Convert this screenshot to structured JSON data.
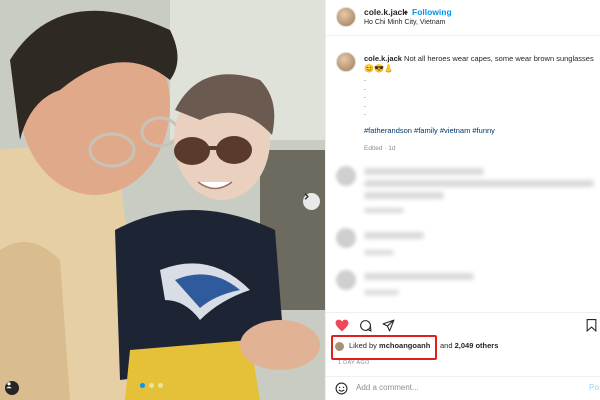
{
  "post": {
    "username": "cole.k.jack",
    "follow_label": "Following",
    "location": "Ho Chi Minh City, Vietnam",
    "caption_text": "Not all heroes wear capes, some wear brown sunglasses",
    "caption_emojis": "😊😎👃",
    "caption_dots": [
      ".",
      ".",
      ".",
      ".",
      "."
    ],
    "hashtags": "#fatherandson #family #vietnam #funny",
    "edited_label": "Edited · 1d",
    "likes_prefix": "Liked by",
    "likes_user": "mchoangoanh",
    "likes_and": "and",
    "likes_others": "2,049 others",
    "time_ago": "1 DAY AGO",
    "comment_placeholder": "Add a comment...",
    "post_label": "Post"
  },
  "colors": {
    "accent": "#0095f6",
    "like": "#ed4956",
    "highlight": "#e0201b"
  },
  "icons": {
    "like": "heart-icon",
    "comment": "comment-icon",
    "share": "share-icon",
    "save": "bookmark-icon",
    "emoji": "smiley-icon",
    "carousel": "chevron-right-icon"
  }
}
